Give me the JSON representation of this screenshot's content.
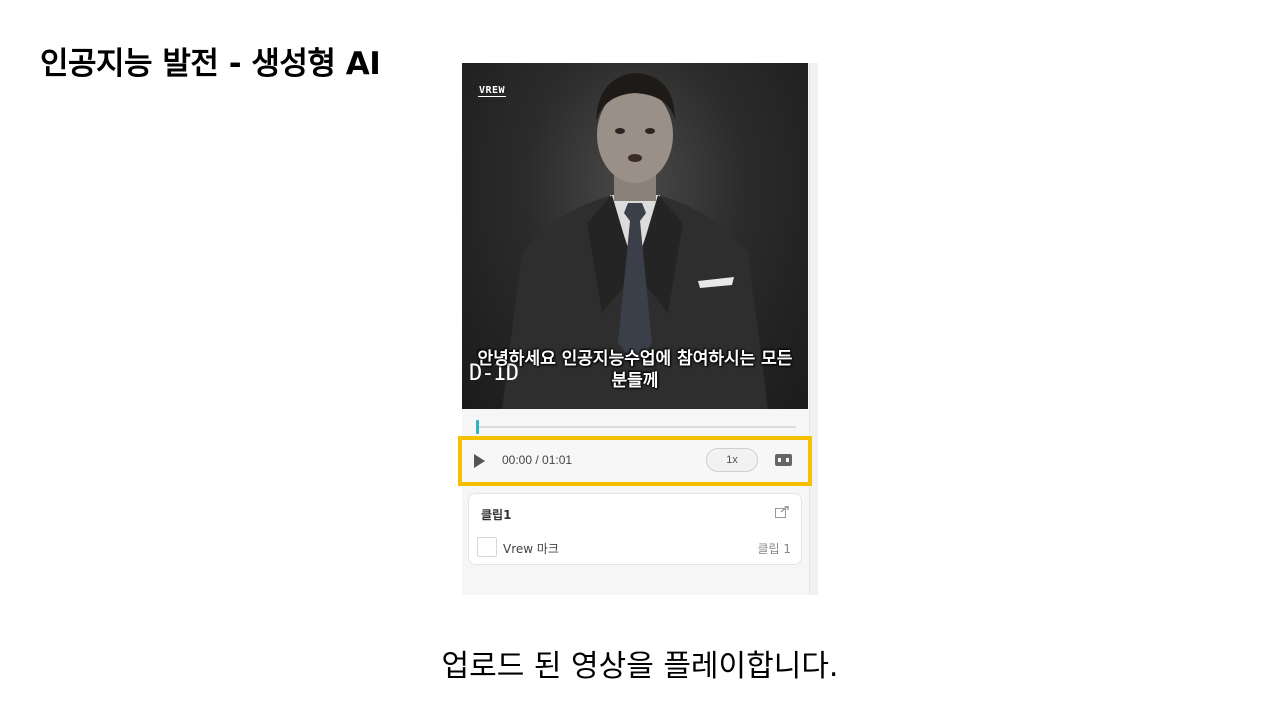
{
  "slide": {
    "title": "인공지능 발전 - 생성형 AI",
    "caption": "업로드 된 영상을 플레이합니다."
  },
  "player": {
    "watermark": "VREW",
    "brand_mark": "D-ID",
    "subtitle": "안녕하세요 인공지능수업에 참여하시는 모든 분들께",
    "time": "00:00 / 01:01",
    "speed": "1x",
    "progress_percent": 0,
    "highlight_color": "#f5c000",
    "accent_color": "#2bb3c0"
  },
  "clip": {
    "title": "클립1",
    "items": [
      {
        "label": "Vrew 마크",
        "meta": "클립 1",
        "checked": false
      }
    ]
  },
  "icons": [
    "play-icon",
    "aspect-ratio-icon",
    "open-external-icon"
  ]
}
